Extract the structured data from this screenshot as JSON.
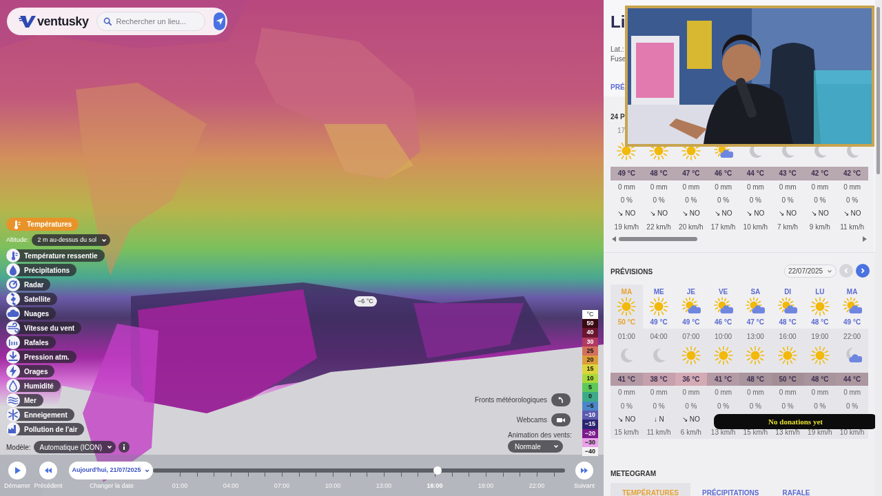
{
  "header": {
    "logo": "ventusky",
    "search_placeholder": "Rechercher un lieu..."
  },
  "map_tooltip": "−6 °C",
  "primary_layer": {
    "label": "Températures",
    "selected": true
  },
  "altitude": {
    "label": "Altitude:",
    "value": "2 m au-dessus du sol"
  },
  "layers": [
    {
      "label": "Température ressentie",
      "selected": false
    },
    {
      "label": "Précipitations",
      "selected": false
    },
    {
      "label": "Radar",
      "selected": false
    },
    {
      "label": "Satellite",
      "selected": false
    },
    {
      "label": "Nuages",
      "selected": false
    },
    {
      "label": "Vitesse du vent",
      "selected": false
    },
    {
      "label": "Rafales",
      "selected": false
    },
    {
      "label": "Pression atm.",
      "selected": false
    },
    {
      "label": "Orages",
      "selected": false
    },
    {
      "label": "Humidité",
      "selected": false
    },
    {
      "label": "Mer",
      "selected": false
    },
    {
      "label": "Enneigement",
      "selected": false
    },
    {
      "label": "Pollution de l'air",
      "selected": false
    }
  ],
  "model": {
    "label": "Modèle:",
    "value": "Automatique (ICON)"
  },
  "legend": {
    "unit": "°C",
    "steps": [
      {
        "label": "50",
        "color": "#3a0a14"
      },
      {
        "label": "40",
        "color": "#6a1630"
      },
      {
        "label": "30",
        "color": "#b03a62"
      },
      {
        "label": "25",
        "color": "#d2705c"
      },
      {
        "label": "20",
        "color": "#dc9c3c"
      },
      {
        "label": "15",
        "color": "#dcd43c"
      },
      {
        "label": "10",
        "color": "#a8d83c"
      },
      {
        "label": "5",
        "color": "#5cc85a"
      },
      {
        "label": "0",
        "color": "#3caa86"
      },
      {
        "label": "−5",
        "color": "#4c86c8"
      },
      {
        "label": "−10",
        "color": "#5a5ab0"
      },
      {
        "label": "−15",
        "color": "#2a2470"
      },
      {
        "label": "−20",
        "color": "#7c1a8c"
      },
      {
        "label": "−30",
        "color": "#e8a2e8"
      },
      {
        "label": "−40",
        "color": "#f2f2f2"
      }
    ]
  },
  "fronts": {
    "label": "Fronts météorologiques"
  },
  "webcams": {
    "label": "Webcams"
  },
  "wind_animation": {
    "label": "Animation des vents:",
    "value": "Normale"
  },
  "timeline": {
    "play": "Démarrer",
    "prev": "Précédent",
    "date": "Aujourd'hui, 21/07/2025",
    "date_caption": "Changer la date",
    "next": "Suivant",
    "level": 0.69,
    "hours": [
      {
        "label": "01:00",
        "selected": false
      },
      {
        "label": "04:00",
        "selected": false
      },
      {
        "label": "07:00",
        "selected": false
      },
      {
        "label": "10:00",
        "selected": false
      },
      {
        "label": "13:00",
        "selected": false
      },
      {
        "label": "16:00",
        "selected": true
      },
      {
        "label": "19:00",
        "selected": false
      },
      {
        "label": "22:00",
        "selected": false
      }
    ]
  },
  "location": {
    "title": "Li",
    "lat": "Lat.:",
    "zone": "Fuse",
    "tab": "PRÉ"
  },
  "strip": {
    "title": "24 P",
    "first_time": "17",
    "cells": [
      {
        "kind": "sun",
        "temp": "49 °C",
        "rain": "0 mm",
        "prob": "0 %",
        "wind_dir": "↘ NO",
        "wind": "19 km/h"
      },
      {
        "kind": "sun",
        "temp": "48 °C",
        "rain": "0 mm",
        "prob": "0 %",
        "wind_dir": "↘ NO",
        "wind": "22 km/h"
      },
      {
        "kind": "sun",
        "temp": "47 °C",
        "rain": "0 mm",
        "prob": "0 %",
        "wind_dir": "↘ NO",
        "wind": "20 km/h"
      },
      {
        "kind": "sun-cloud",
        "temp": "46 °C",
        "rain": "0 mm",
        "prob": "0 %",
        "wind_dir": "↘ NO",
        "wind": "17 km/h"
      },
      {
        "kind": "moon",
        "temp": "44 °C",
        "rain": "0 mm",
        "prob": "0 %",
        "wind_dir": "↘ NO",
        "wind": "10 km/h"
      },
      {
        "kind": "moon",
        "temp": "43 °C",
        "rain": "0 mm",
        "prob": "0 %",
        "wind_dir": "↘ NO",
        "wind": "7 km/h"
      },
      {
        "kind": "moon",
        "temp": "42 °C",
        "rain": "0 mm",
        "prob": "0 %",
        "wind_dir": "↘ NO",
        "wind": "9 km/h"
      },
      {
        "kind": "moon",
        "temp": "42 °C",
        "rain": "0 mm",
        "prob": "0 %",
        "wind_dir": "↘ NO",
        "wind": "11 km/h"
      }
    ]
  },
  "forecast": {
    "title": "PRÉVISIONS",
    "date": "22/07/2025",
    "prev_disabled": true,
    "next_disabled": false,
    "days": [
      {
        "day": "MA",
        "kind": "sun",
        "temp": "50 °C",
        "selected": true
      },
      {
        "day": "ME",
        "kind": "sun",
        "temp": "49 °C",
        "selected": false
      },
      {
        "day": "JE",
        "kind": "sun-cloud",
        "temp": "49 °C",
        "selected": false
      },
      {
        "day": "VE",
        "kind": "sun-cloud",
        "temp": "46 °C",
        "selected": false
      },
      {
        "day": "SA",
        "kind": "sun-cloud",
        "temp": "47 °C",
        "selected": false
      },
      {
        "day": "DI",
        "kind": "sun-cloud",
        "temp": "48 °C",
        "selected": false
      },
      {
        "day": "LU",
        "kind": "sun",
        "temp": "48 °C",
        "selected": false
      },
      {
        "day": "MA",
        "kind": "sun-cloud",
        "temp": "49 °C",
        "selected": false
      }
    ],
    "hours": [
      {
        "time": "01:00",
        "kind": "moon",
        "temp": "41 °C",
        "color": "#b49aa4",
        "rain": "0 mm",
        "prob": "0 %",
        "wind_dir": "↘ NO",
        "wind": "15 km/h"
      },
      {
        "time": "04:00",
        "kind": "moon",
        "temp": "38 °C",
        "color": "#c6a0ac",
        "rain": "0 mm",
        "prob": "0 %",
        "wind_dir": "↓ N",
        "wind": "11 km/h"
      },
      {
        "time": "07:00",
        "kind": "sun",
        "temp": "36 °C",
        "color": "#d4aab4",
        "rain": "0 mm",
        "prob": "0 %",
        "wind_dir": "↘ NO",
        "wind": "6 km/h"
      },
      {
        "time": "10:00",
        "kind": "sun",
        "temp": "41 °C",
        "color": "#b49aa4",
        "rain": "0 mm",
        "prob": "0 %",
        "wind": "13 km/h"
      },
      {
        "time": "13:00",
        "kind": "sun",
        "temp": "48 °C",
        "color": "#a8949c",
        "rain": "0 mm",
        "prob": "0 %",
        "wind": "15 km/h"
      },
      {
        "time": "16:00",
        "kind": "sun",
        "temp": "50 °C",
        "color": "#a48e96",
        "rain": "0 mm",
        "prob": "0 %",
        "wind": "13 km/h"
      },
      {
        "time": "19:00",
        "kind": "sun",
        "temp": "48 °C",
        "color": "#a8949c",
        "rain": "0 mm",
        "prob": "0 %",
        "wind": "19 km/h"
      },
      {
        "time": "22:00",
        "kind": "moon-cloud",
        "temp": "44 °C",
        "color": "#ac979f",
        "rain": "0 mm",
        "prob": "0 %",
        "wind": "10 km/h"
      }
    ]
  },
  "donation_banner": "No donations yet",
  "meteogram": {
    "title": "METEOGRAM",
    "tabs": [
      {
        "label": "TEMPÉRATURES",
        "selected": true
      },
      {
        "label": "PRÉCIPITATIONS",
        "selected": false
      },
      {
        "label": "RAFALE",
        "selected": false
      }
    ]
  }
}
